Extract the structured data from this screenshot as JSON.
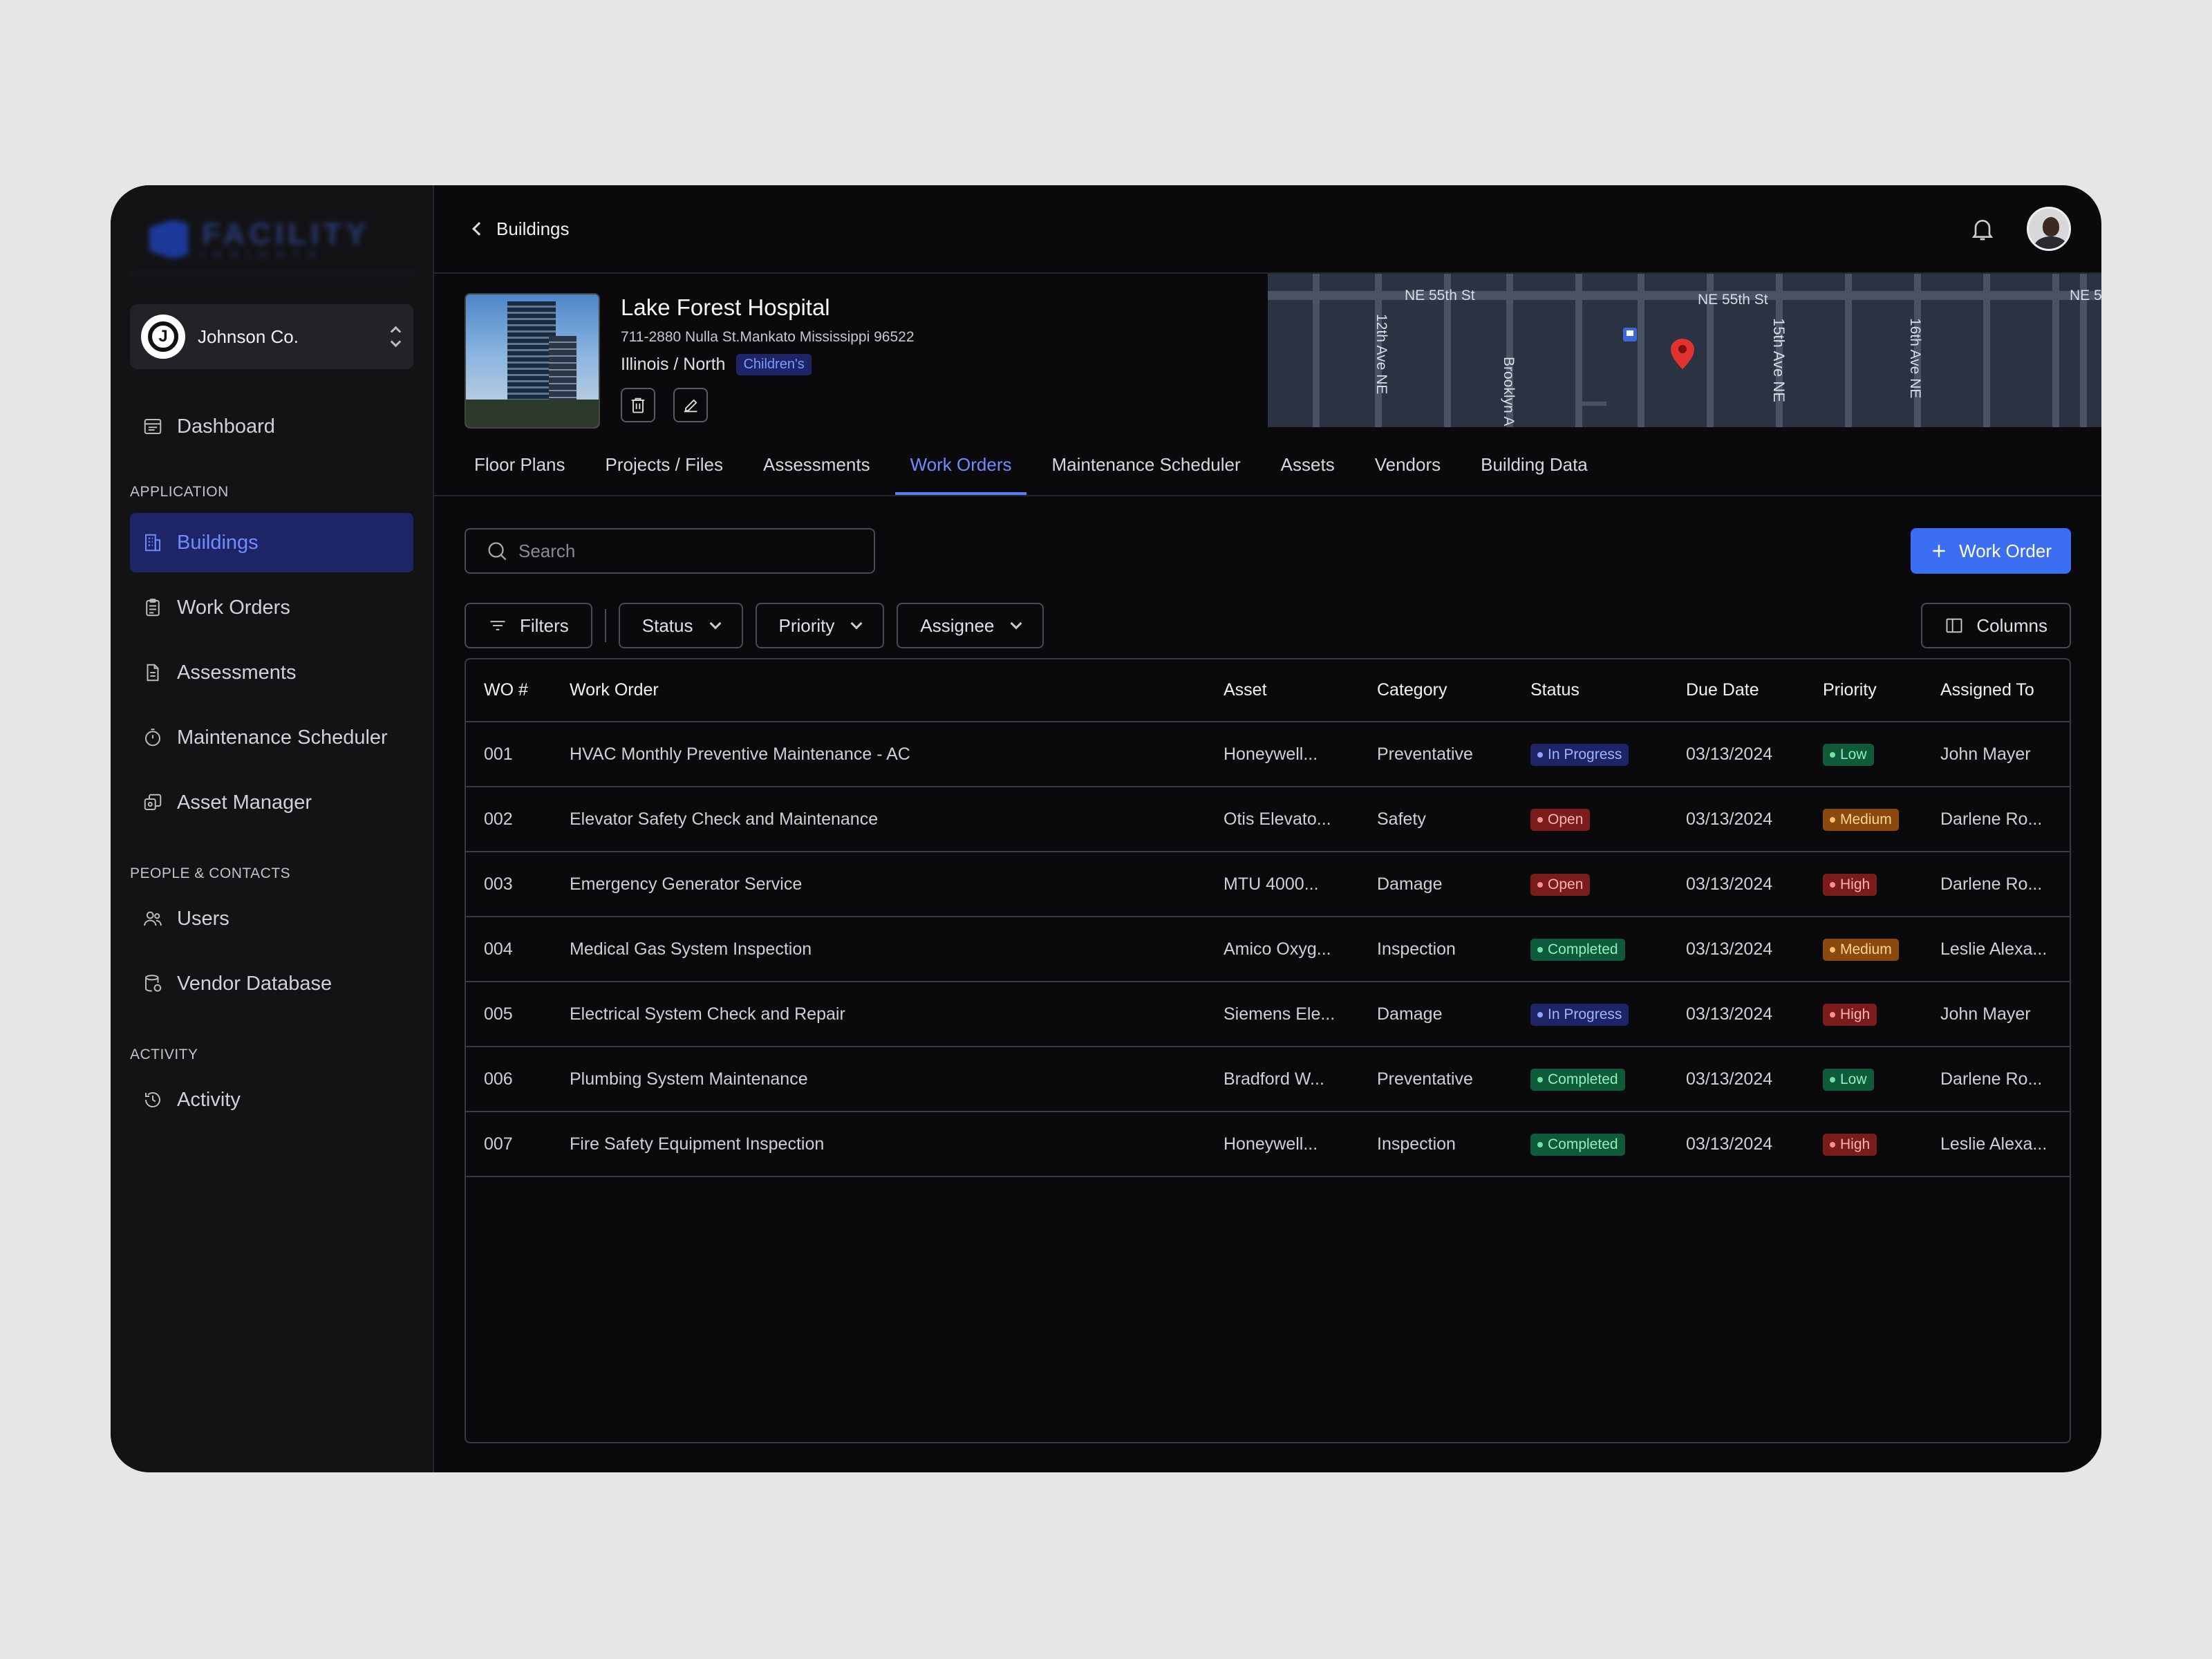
{
  "sidebar": {
    "org_name": "Johnson Co.",
    "org_initial": "J",
    "dashboard": "Dashboard",
    "sections": {
      "application": "APPLICATION",
      "people": "PEOPLE & CONTACTS",
      "activity": "ACTIVITY"
    },
    "items": {
      "buildings": "Buildings",
      "work_orders": "Work Orders",
      "assessments": "Assessments",
      "maintenance": "Maintenance Scheduler",
      "asset_manager": "Asset Manager",
      "users": "Users",
      "vendor_db": "Vendor Database",
      "activity": "Activity"
    }
  },
  "topbar": {
    "back_label": "Buildings"
  },
  "building": {
    "name": "Lake Forest Hospital",
    "address": "711-2880 Nulla St.Mankato Mississippi 96522",
    "region": "Illinois / North",
    "tag": "Children's"
  },
  "map": {
    "streets": [
      "NE 55th St",
      "NE 55th St",
      "NE 5",
      "12th Ave NE",
      "Brooklyn A",
      "15th Ave NE",
      "16th Ave NE"
    ]
  },
  "tabs": [
    "Floor Plans",
    "Projects / Files",
    "Assessments",
    "Work Orders",
    "Maintenance Scheduler",
    "Assets",
    "Vendors",
    "Building Data"
  ],
  "active_tab": "Work Orders",
  "search": {
    "placeholder": "Search"
  },
  "new_button": "Work Order",
  "filters": {
    "filters": "Filters",
    "status": "Status",
    "priority": "Priority",
    "assignee": "Assignee",
    "columns": "Columns"
  },
  "table": {
    "headers": [
      "WO #",
      "Work Order",
      "Asset",
      "Category",
      "Status",
      "Due Date",
      "Priority",
      "Assigned To"
    ],
    "rows": [
      [
        "001",
        "HVAC Monthly Preventive Maintenance - AC",
        "Honeywell...",
        "Preventative",
        "In Progress",
        "03/13/2024",
        "Low",
        "John Mayer"
      ],
      [
        "002",
        "Elevator Safety Check and Maintenance",
        "Otis Elevato...",
        "Safety",
        "Open",
        "03/13/2024",
        "Medium",
        "Darlene Ro..."
      ],
      [
        "003",
        "Emergency Generator Service",
        "MTU 4000...",
        "Damage",
        "Open",
        "03/13/2024",
        "High",
        "Darlene Ro..."
      ],
      [
        "004",
        "Medical Gas System Inspection",
        "Amico Oxyg...",
        "Inspection",
        "Completed",
        "03/13/2024",
        "Medium",
        "Leslie Alexa..."
      ],
      [
        "005",
        "Electrical System Check and Repair",
        "Siemens Ele...",
        "Damage",
        "In Progress",
        "03/13/2024",
        "High",
        "John Mayer"
      ],
      [
        "006",
        "Plumbing System Maintenance",
        "Bradford W...",
        "Preventative",
        "Completed",
        "03/13/2024",
        "Low",
        "Darlene Ro..."
      ],
      [
        "007",
        "Fire Safety Equipment Inspection",
        "Honeywell...",
        "Inspection",
        "Completed",
        "03/13/2024",
        "High",
        "Leslie Alexa..."
      ]
    ]
  },
  "colors": {
    "accent": "#3b6ef0",
    "active_nav_bg": "#1e2567",
    "active_text": "#6f8cff"
  }
}
